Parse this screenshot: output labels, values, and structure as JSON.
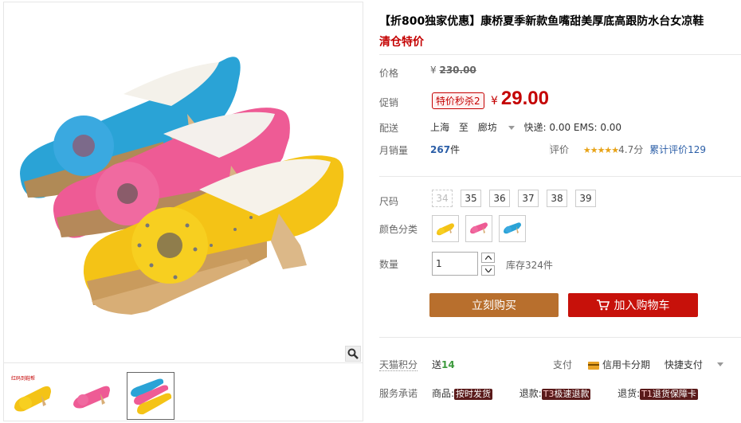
{
  "product": {
    "title": "【折800独家优惠】康桥夏季新款鱼嘴甜美厚底高跟防水台女凉鞋",
    "subtitle": "清仓特价"
  },
  "price": {
    "label": "价格",
    "currency": "¥",
    "original": "230.00"
  },
  "promo": {
    "label": "促销",
    "tag": "特价秒杀2",
    "currency": "¥",
    "price": "29.00"
  },
  "shipping": {
    "label": "配送",
    "from": "上海",
    "to_word": "至",
    "dest": "廊坊",
    "fee": "快递: 0.00 EMS: 0.00"
  },
  "sales": {
    "label": "月销量",
    "count": "267",
    "unit": "件",
    "rating_label": "评价",
    "stars": "★★★★★",
    "score": "4.7分",
    "review_link": "累计评价129"
  },
  "size": {
    "label": "尺码",
    "options": [
      "34",
      "35",
      "36",
      "37",
      "38",
      "39"
    ]
  },
  "color": {
    "label": "颜色分类",
    "options": [
      "yellow",
      "pink",
      "blue"
    ]
  },
  "quantity": {
    "label": "数量",
    "value": "1",
    "stock": "库存324件"
  },
  "buttons": {
    "buy": "立刻购买",
    "cart": "加入购物车"
  },
  "points": {
    "label": "天猫积分",
    "prefix": "送",
    "value": "14"
  },
  "payment": {
    "label": "支付",
    "credit": "信用卡分期",
    "quick": "快捷支付"
  },
  "service": {
    "label": "服务承诺",
    "item1_label": "商品:",
    "item1_tag": "按时发货",
    "item2_label": "退款:",
    "item2_code": "T3",
    "item2_tag": "极速退款",
    "item3_label": "退货:",
    "item3_code": "T1",
    "item3_tag": "退货保障卡"
  },
  "thumb_caption": "红码到鞋帮",
  "colors": {
    "accent_red": "#c40000",
    "buy_btn": "#b86f2d",
    "cart_btn": "#c7110a",
    "link_blue": "#2b5ea7"
  }
}
